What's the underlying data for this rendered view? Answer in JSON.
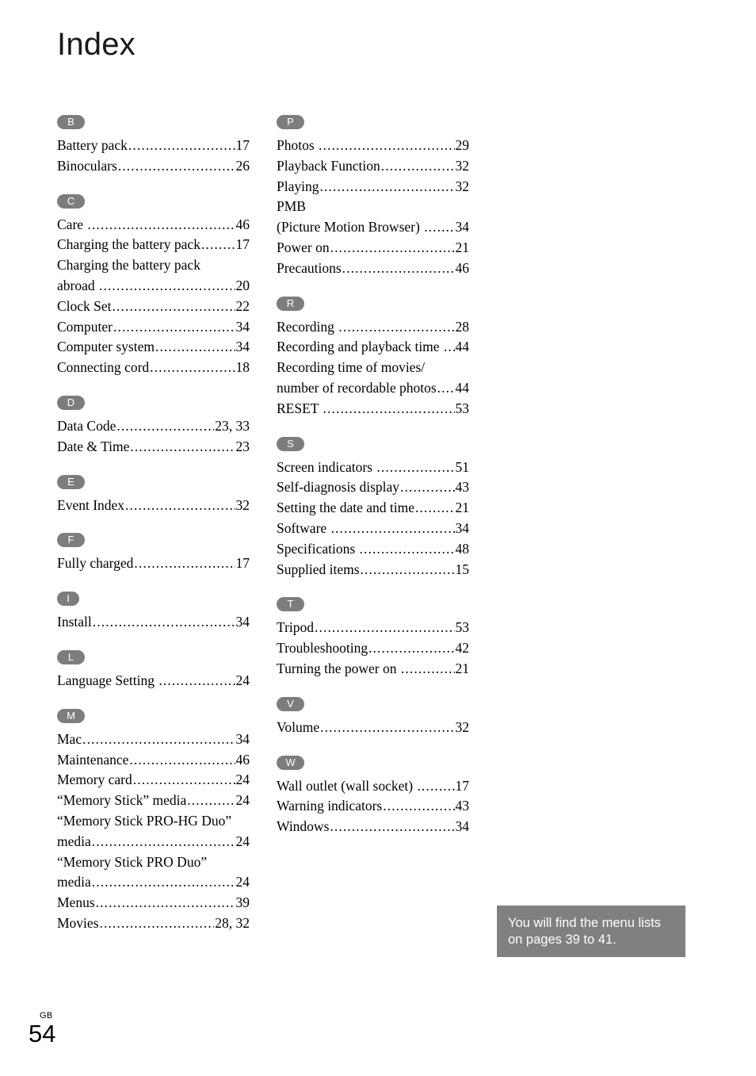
{
  "page": {
    "title": "Index",
    "locale_code": "GB",
    "page_number": "54"
  },
  "note": {
    "text": "You will find the menu lists\non pages 39 to 41."
  },
  "columns": [
    {
      "name": "left-column",
      "groups": [
        {
          "letter": "B",
          "entries": [
            {
              "term": "Battery pack",
              "page": "17"
            },
            {
              "term": "Binoculars",
              "page": "26"
            }
          ]
        },
        {
          "letter": "C",
          "entries": [
            {
              "term": "Care ",
              "page": "46"
            },
            {
              "term": "Charging the battery pack",
              "page": "17"
            },
            {
              "term": "Charging the battery pack",
              "term2": "abroad ",
              "page": "20"
            },
            {
              "term": "Clock Set",
              "page": "22"
            },
            {
              "term": "Computer",
              "page": "34"
            },
            {
              "term": "Computer system",
              "page": "34"
            },
            {
              "term": "Connecting cord",
              "page": "18"
            }
          ]
        },
        {
          "letter": "D",
          "entries": [
            {
              "term": "Data Code",
              "page": "23, 33"
            },
            {
              "term": "Date & Time",
              "page": "23"
            }
          ]
        },
        {
          "letter": "E",
          "entries": [
            {
              "term": "Event Index",
              "page": "32"
            }
          ]
        },
        {
          "letter": "F",
          "entries": [
            {
              "term": "Fully charged",
              "page": "17"
            }
          ]
        },
        {
          "letter": "I",
          "narrow": true,
          "entries": [
            {
              "term": "Install",
              "page": "34"
            }
          ]
        },
        {
          "letter": "L",
          "entries": [
            {
              "term": "Language Setting ",
              "page": "24"
            }
          ]
        },
        {
          "letter": "M",
          "entries": [
            {
              "term": "Mac",
              "page": "34"
            },
            {
              "term": "Maintenance",
              "page": "46"
            },
            {
              "term": "Memory card",
              "page": "24"
            },
            {
              "term": "“Memory Stick” media",
              "page": "24"
            },
            {
              "term": "“Memory Stick PRO-HG Duo”",
              "term2": "media",
              "page": "24"
            },
            {
              "term": "“Memory Stick PRO Duo”",
              "term2": "media",
              "page": "24"
            },
            {
              "term": "Menus",
              "page": "39"
            },
            {
              "term": "Movies",
              "page": "28, 32"
            }
          ]
        }
      ]
    },
    {
      "name": "right-column",
      "groups": [
        {
          "letter": "P",
          "entries": [
            {
              "term": "Photos ",
              "page": "29"
            },
            {
              "term": "Playback Function",
              "page": "32"
            },
            {
              "term": "Playing",
              "page": "32"
            },
            {
              "term": "PMB",
              "term2": "(Picture Motion Browser) ",
              "page": "34"
            },
            {
              "term": "Power on",
              "page": "21"
            },
            {
              "term": "Precautions",
              "page": "46"
            }
          ]
        },
        {
          "letter": "R",
          "entries": [
            {
              "term": "Recording ",
              "page": "28"
            },
            {
              "term": "Recording and playback time ",
              "page": "44"
            },
            {
              "term": "Recording time of movies/",
              "term2": "number of recordable photos",
              "page": "44"
            },
            {
              "term": "RESET ",
              "page": "53"
            }
          ]
        },
        {
          "letter": "S",
          "entries": [
            {
              "term": "Screen indicators ",
              "page": "51"
            },
            {
              "term": "Self-diagnosis display",
              "page": "43"
            },
            {
              "term": "Setting the date and time",
              "page": "21"
            },
            {
              "term": "Software ",
              "page": "34"
            },
            {
              "term": "Specifications ",
              "page": "48"
            },
            {
              "term": "Supplied items",
              "page": "15"
            }
          ]
        },
        {
          "letter": "T",
          "entries": [
            {
              "term": "Tripod",
              "page": "53"
            },
            {
              "term": "Troubleshooting",
              "page": "42"
            },
            {
              "term": "Turning the power on ",
              "page": "21"
            }
          ]
        },
        {
          "letter": "V",
          "entries": [
            {
              "term": "Volume",
              "page": "32"
            }
          ]
        },
        {
          "letter": "W",
          "entries": [
            {
              "term": "Wall outlet (wall socket) ",
              "page": "17"
            },
            {
              "term": "Warning indicators",
              "page": "43"
            },
            {
              "term": "Windows",
              "page": "34"
            }
          ]
        }
      ]
    }
  ]
}
